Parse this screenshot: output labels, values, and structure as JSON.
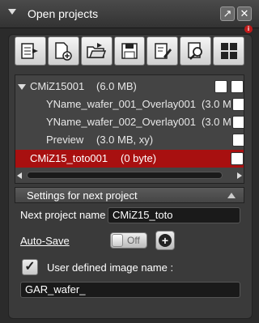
{
  "window": {
    "title": "Open projects",
    "pin_icon": "pin-icon",
    "close_icon": "close-icon",
    "info_badge": "i"
  },
  "toolbar": {
    "tools": [
      "open-project-icon",
      "new-project-icon",
      "open-folder-icon",
      "save-icon",
      "edit-icon",
      "find-icon",
      "grid-layout-icon"
    ]
  },
  "projects": {
    "rows": [
      {
        "name": "CMiZ15001",
        "size": "(6.0 MB)",
        "level": 0,
        "expanded": true,
        "selected": false
      },
      {
        "name": "YName_wafer_001_Overlay001",
        "size": "(3.0 M",
        "level": 1,
        "selected": false
      },
      {
        "name": "YName_wafer_002_Overlay001",
        "size": "(3.0 M",
        "level": 1,
        "selected": false
      },
      {
        "name": "Preview",
        "size": "(3.0 MB, xy)",
        "level": 1,
        "selected": false
      },
      {
        "name": "CMiZ15_toto001",
        "size": "(0 byte)",
        "level": 0,
        "selected": true
      }
    ]
  },
  "settings": {
    "header": "Settings for next project",
    "next_project_label": "Next project name",
    "next_project_value": "CMiZ15_toto",
    "autosave_label": "Auto-Save",
    "autosave_state": "Off",
    "user_image_label": "User defined image name :",
    "user_image_checked": true,
    "image_name_value": "GAR_wafer_"
  },
  "colors": {
    "selection": "#a81010",
    "background": "#2b2b2b",
    "panel": "#3a3a3a"
  }
}
